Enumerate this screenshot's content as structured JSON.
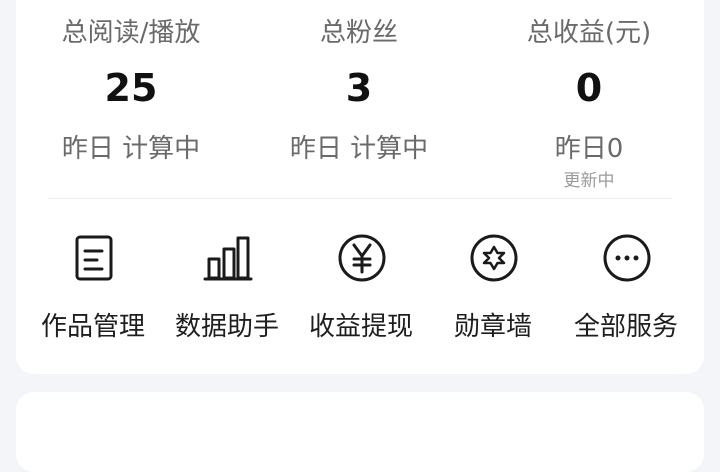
{
  "stats": [
    {
      "label": "总阅读/播放",
      "value": "25",
      "sub": "昨日 计算中",
      "note": ""
    },
    {
      "label": "总粉丝",
      "value": "3",
      "sub": "昨日 计算中",
      "note": ""
    },
    {
      "label": "总收益(元)",
      "value": "0",
      "sub": "昨日0",
      "note": "更新中"
    }
  ],
  "services": [
    {
      "label": "作品管理",
      "icon": "document-icon"
    },
    {
      "label": "数据助手",
      "icon": "bar-chart-icon"
    },
    {
      "label": "收益提现",
      "icon": "yen-coin-icon"
    },
    {
      "label": "勋章墙",
      "icon": "star-badge-icon"
    },
    {
      "label": "全部服务",
      "icon": "more-dots-icon"
    }
  ],
  "colors": {
    "background": "#f4f5f8",
    "card": "#ffffff",
    "text": "#222222",
    "muted": "#6a6a6a"
  }
}
